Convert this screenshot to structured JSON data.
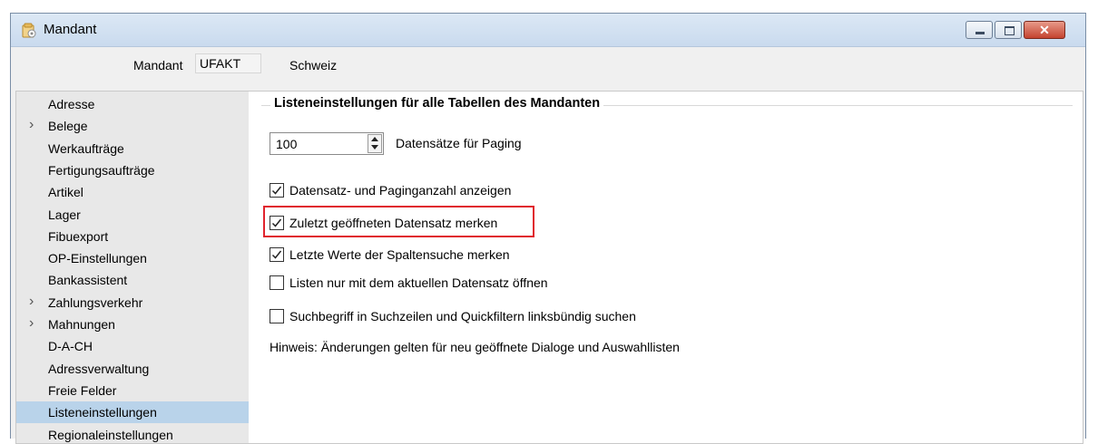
{
  "window": {
    "title": "Mandant",
    "controls": {
      "minimize": "minimize",
      "maximize": "maximize",
      "close": "✕"
    }
  },
  "mandant": {
    "label": "Mandant",
    "code": "UFAKT",
    "name": "Schweiz"
  },
  "nav": {
    "items": [
      {
        "label": "Adresse",
        "expandable": false,
        "selected": false
      },
      {
        "label": "Belege",
        "expandable": true,
        "selected": false
      },
      {
        "label": "Werkaufträge",
        "expandable": false,
        "selected": false
      },
      {
        "label": "Fertigungsaufträge",
        "expandable": false,
        "selected": false
      },
      {
        "label": "Artikel",
        "expandable": false,
        "selected": false
      },
      {
        "label": "Lager",
        "expandable": false,
        "selected": false
      },
      {
        "label": "Fibuexport",
        "expandable": false,
        "selected": false
      },
      {
        "label": "OP-Einstellungen",
        "expandable": false,
        "selected": false
      },
      {
        "label": "Bankassistent",
        "expandable": false,
        "selected": false
      },
      {
        "label": "Zahlungsverkehr",
        "expandable": true,
        "selected": false
      },
      {
        "label": "Mahnungen",
        "expandable": true,
        "selected": false
      },
      {
        "label": "D-A-CH",
        "expandable": false,
        "selected": false
      },
      {
        "label": "Adressverwaltung",
        "expandable": false,
        "selected": false
      },
      {
        "label": "Freie Felder",
        "expandable": false,
        "selected": false
      },
      {
        "label": "Listeneinstellungen",
        "expandable": false,
        "selected": true
      },
      {
        "label": "Regionaleinstellungen",
        "expandable": false,
        "selected": false
      }
    ],
    "chevron": "›"
  },
  "settings": {
    "group_title": "Listeneinstellungen für alle Tabellen des Mandanten",
    "paging": {
      "value": "100",
      "label": "Datensätze für Paging"
    },
    "options": [
      {
        "label": "Datensatz- und Paginganzahl anzeigen",
        "checked": true
      },
      {
        "label": "Zuletzt geöffneten Datensatz merken",
        "checked": true,
        "highlighted": true
      },
      {
        "label": "Letzte Werte der Spaltensuche merken",
        "checked": true
      },
      {
        "label": "Listen nur mit dem aktuellen Datensatz öffnen",
        "checked": false
      },
      {
        "label": "Suchbegriff in Suchzeilen und Quickfiltern linksbündig suchen",
        "checked": false
      }
    ],
    "hint": "Hinweis: Änderungen gelten für neu geöffnete Dialoge und Auswahllisten"
  },
  "colors": {
    "selected_nav": "#b9d3ea",
    "highlight_border": "#e0232d"
  }
}
